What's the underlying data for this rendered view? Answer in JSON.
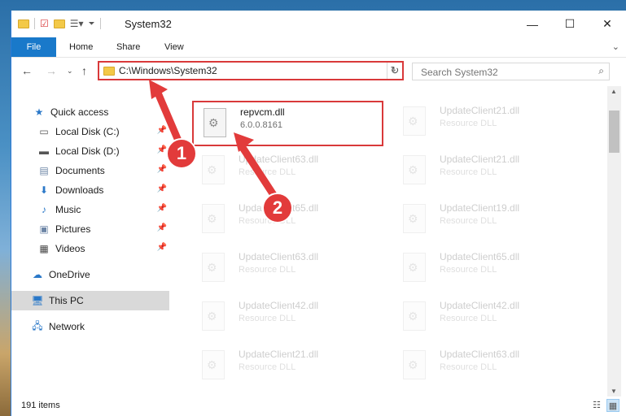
{
  "window": {
    "title": "System32"
  },
  "ribbon": {
    "tabs": [
      "File",
      "Home",
      "Share",
      "View"
    ]
  },
  "address": {
    "path": "C:\\Windows\\System32"
  },
  "search": {
    "placeholder": "Search System32"
  },
  "sidebar": {
    "items": [
      {
        "label": "Quick access",
        "icon": "star-icon",
        "pinned": false
      },
      {
        "label": "Local Disk (C:)",
        "icon": "drive-icon",
        "pinned": true
      },
      {
        "label": "Local Disk (D:)",
        "icon": "drive-icon",
        "pinned": true
      },
      {
        "label": "Documents",
        "icon": "documents-icon",
        "pinned": true
      },
      {
        "label": "Downloads",
        "icon": "download-icon",
        "pinned": true
      },
      {
        "label": "Music",
        "icon": "music-icon",
        "pinned": true
      },
      {
        "label": "Pictures",
        "icon": "pictures-icon",
        "pinned": true
      },
      {
        "label": "Videos",
        "icon": "videos-icon",
        "pinned": true
      },
      {
        "label": "OneDrive",
        "icon": "cloud-icon",
        "pinned": false
      },
      {
        "label": "This PC",
        "icon": "computer-icon",
        "pinned": false,
        "selected": true
      },
      {
        "label": "Network",
        "icon": "network-icon",
        "pinned": false
      }
    ]
  },
  "files": [
    {
      "name": "repvcm.dll",
      "desc": "6.0.0.8161",
      "highlight": true
    },
    {
      "name": "UpdateClient21.dll",
      "desc": "Resource DLL"
    },
    {
      "name": "UpdateClient63.dll",
      "desc": "Resource DLL"
    },
    {
      "name": "UpdateClient21.dll",
      "desc": "Resource DLL"
    },
    {
      "name": "UpdateClient65.dll",
      "desc": "Resource DLL"
    },
    {
      "name": "UpdateClient19.dll",
      "desc": "Resource DLL"
    },
    {
      "name": "UpdateClient63.dll",
      "desc": "Resource DLL"
    },
    {
      "name": "UpdateClient65.dll",
      "desc": "Resource DLL"
    },
    {
      "name": "UpdateClient42.dll",
      "desc": "Resource DLL"
    },
    {
      "name": "UpdateClient42.dll",
      "desc": "Resource DLL"
    },
    {
      "name": "UpdateClient21.dll",
      "desc": "Resource DLL"
    },
    {
      "name": "UpdateClient63.dll",
      "desc": "Resource DLL"
    }
  ],
  "status": {
    "item_count": "191 items"
  },
  "annotations": {
    "step1": "1",
    "step2": "2",
    "color": "#e23b3b"
  }
}
